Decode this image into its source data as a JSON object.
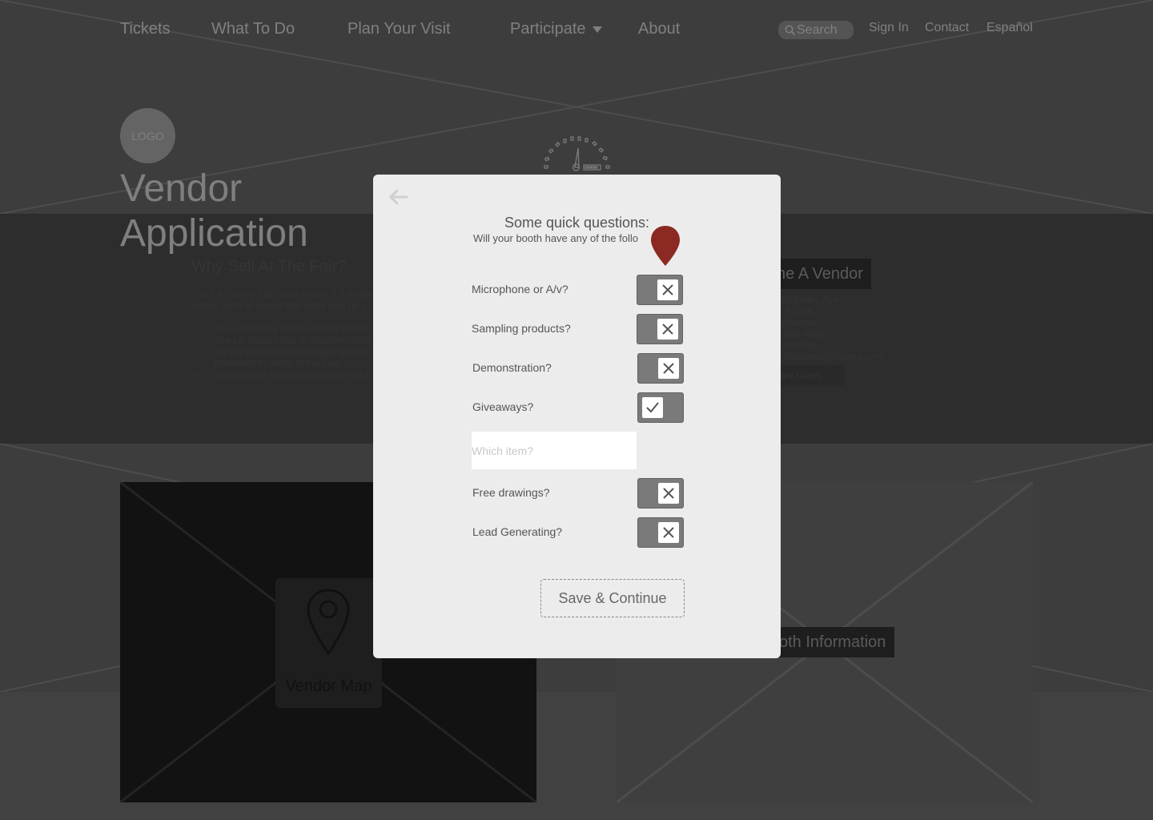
{
  "nav": {
    "tickets": "Tickets",
    "what_to_do": "What To Do",
    "plan_visit": "Plan Your Visit",
    "participate": "Participate",
    "about": "About",
    "search_placeholder": "Search",
    "sign_in": "Sign In",
    "contact": "Contact",
    "espanol": "Español"
  },
  "logo": {
    "text": "LOGO"
  },
  "hero": {
    "title": "Vendor Application"
  },
  "background": {
    "why_heading": "Why Sell At The Fair?",
    "why_paragraph_1": "The LA County Fair hosts nearly 1.3 million",
    "why_paragraph_2": "million pairs of hands that could pick up y",
    "bullets": [
      "The LA County Fair is ranked among",
      "The LA County Fair is Southern Califo",
      "Surveys indicate that shopping ranks",
      "influencer to come to the Fair",
      "The average household income for L"
    ],
    "become_vendor": "ne A Vendor",
    "address_lines": [
      "McKinley Ave",
      ", 91768",
      "Directions",
      "-865-4500",
      "23-4368",
      "rcialsales@fairplex.com"
    ],
    "dates_button": "ant Dates",
    "vendor_map": "Vendor Map",
    "booth_info": "oth Information"
  },
  "modal": {
    "title": "Some quick questions:",
    "subtitle": "Will your booth have any of the follo",
    "questions": [
      {
        "label": "Microphone or A/v?",
        "checked": false
      },
      {
        "label": "Sampling products?",
        "checked": false
      },
      {
        "label": "Demonstration?",
        "checked": false
      },
      {
        "label": "Giveaways?",
        "checked": true
      },
      {
        "label": "Free drawings?",
        "checked": false
      },
      {
        "label": "Lead Generating?",
        "checked": false
      }
    ],
    "item_placeholder": "Which item?",
    "save_button": "Save & Continue"
  },
  "colors": {
    "pin": "#8b2a22",
    "modal_bg": "#ececec",
    "toggle_bg": "#7a7a7a"
  }
}
